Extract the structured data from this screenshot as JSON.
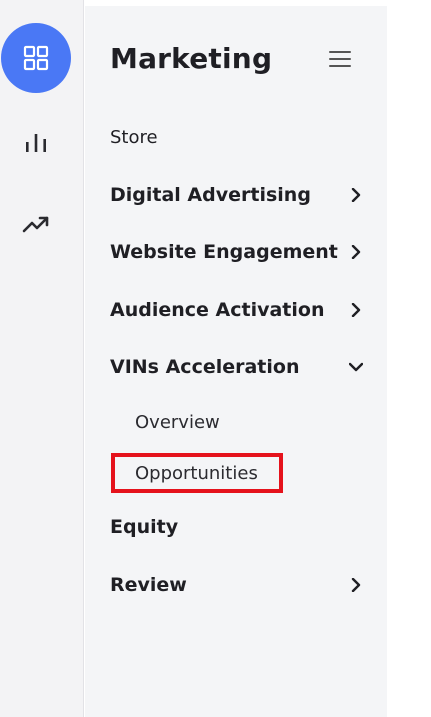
{
  "rail": {
    "items": [
      {
        "icon": "grid-icon",
        "active": true
      },
      {
        "icon": "bar-chart-icon",
        "active": false
      },
      {
        "icon": "trending-up-icon",
        "active": false
      }
    ],
    "accent": "#4a78f5"
  },
  "panel": {
    "title": "Marketing",
    "menu": [
      {
        "label": "Store",
        "style": "plain",
        "chevron": "none"
      },
      {
        "label": "Digital Advertising",
        "style": "bold",
        "chevron": "right"
      },
      {
        "label": "Website Engagement",
        "style": "bold",
        "chevron": "right"
      },
      {
        "label": "Audience Activation",
        "style": "bold",
        "chevron": "right"
      },
      {
        "label": "VINs Acceleration",
        "style": "bold",
        "chevron": "down",
        "children": [
          "Overview",
          "Opportunities"
        ]
      },
      {
        "label": "Equity",
        "style": "bold",
        "chevron": "none"
      },
      {
        "label": "Review",
        "style": "bold",
        "chevron": "right"
      }
    ]
  },
  "highlight": {
    "target": "Opportunities",
    "color": "#e5121c"
  }
}
